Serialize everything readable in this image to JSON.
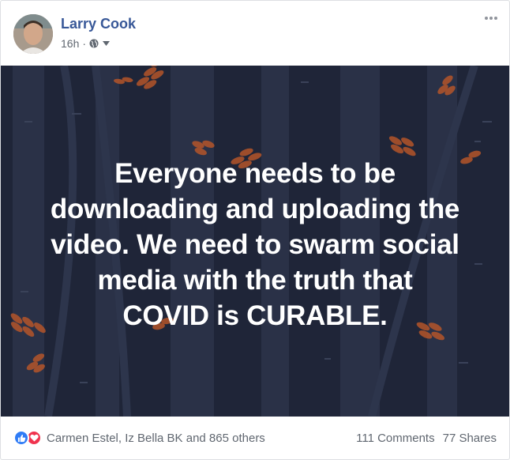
{
  "post": {
    "author": "Larry Cook",
    "time": "16h",
    "separator": "·",
    "text_lines": [
      "Everyone needs to be",
      "downloading and uploading the",
      "video. We need to swarm social",
      "media with the truth that",
      "COVID is CURABLE."
    ],
    "background_color": "#1f2538",
    "accent_leaf_color": "#b5562a"
  },
  "footer": {
    "reaction_icons": [
      "like-icon",
      "love-icon"
    ],
    "reaction_names": "Carmen Estel, Iz Bella BK and 865 others",
    "comments": "111 Comments",
    "shares": "77 Shares"
  },
  "colors": {
    "author_link": "#385898",
    "meta_text": "#606770",
    "like_blue": "#2f7cf6",
    "love_red": "#f0334e"
  }
}
